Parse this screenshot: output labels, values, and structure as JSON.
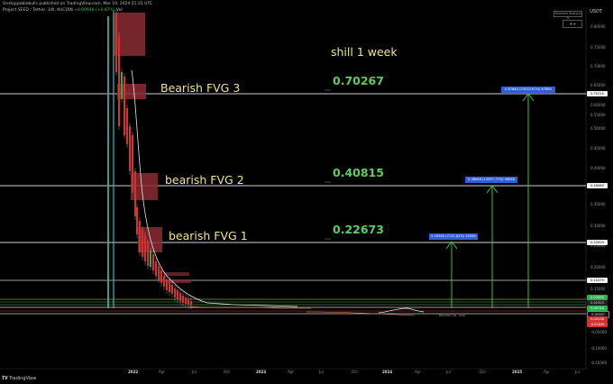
{
  "header": {
    "publisher": "Unstoppablebulls published on TradingView.com, Mar 10, 2024 21:31 UTC",
    "symbol": "Project SEED / Tether, 1W, KUCOIN",
    "change": "+0.00648 (+0.87%)",
    "vol": "Vol",
    "currency": "USDT"
  },
  "controls": {
    "restore_label": "Structure Analysis ▾",
    "settings_label": "⚙ ▾"
  },
  "annotations": {
    "shill": "shill 1 week",
    "fvg3": "Bearish FVG 3",
    "fvg2": "bearish FVG 2",
    "fvg1": "bearish FVG 1",
    "target3": "0.70267",
    "target2": "0.40815",
    "target1": "0.22673"
  },
  "gain_labels": {
    "g1": "0.20564 (7131.82%) 20564",
    "g2": "0.38648 (13397.77%) 38648",
    "g3": "0.67884 (23532.87%) 67884"
  },
  "price_axis": {
    "ticks": [
      "0.80000",
      "0.75000",
      "0.70000",
      "0.65000",
      "0.60000",
      "0.55000",
      "0.50000",
      "0.45000",
      "0.40000",
      "0.35000",
      "0.30000",
      "0.25000",
      "0.20000",
      "0.15000",
      "0.10000",
      "0.05000",
      "-0.05000",
      "-0.10000",
      "-0.15000"
    ],
    "tags": {
      "t70": "0.70215",
      "t40": "0.40660",
      "t22": "0.22629",
      "t10": "0.10479",
      "a": "0.03493",
      "b": "0.02323",
      "c": "0.00744",
      "d": "0.00287",
      "e": "0.00138",
      "f": "-0.02640"
    }
  },
  "time_axis": {
    "labels": [
      "2022",
      "Apr",
      "Jul",
      "Oct",
      "2023",
      "Apr",
      "Jul",
      "Oct",
      "2024",
      "Apr",
      "Jul",
      "Oct",
      "2025",
      "Apr",
      "Jul"
    ]
  },
  "baseline_note": "Bearish Liq. Line",
  "footer": {
    "logo": "TradingView"
  },
  "colors": {
    "background": "#000000",
    "annotation": "#f0e68c",
    "target": "#5fcc5f",
    "arrow": "#3fbf3f",
    "gain_tag": "#2d5fdb"
  }
}
